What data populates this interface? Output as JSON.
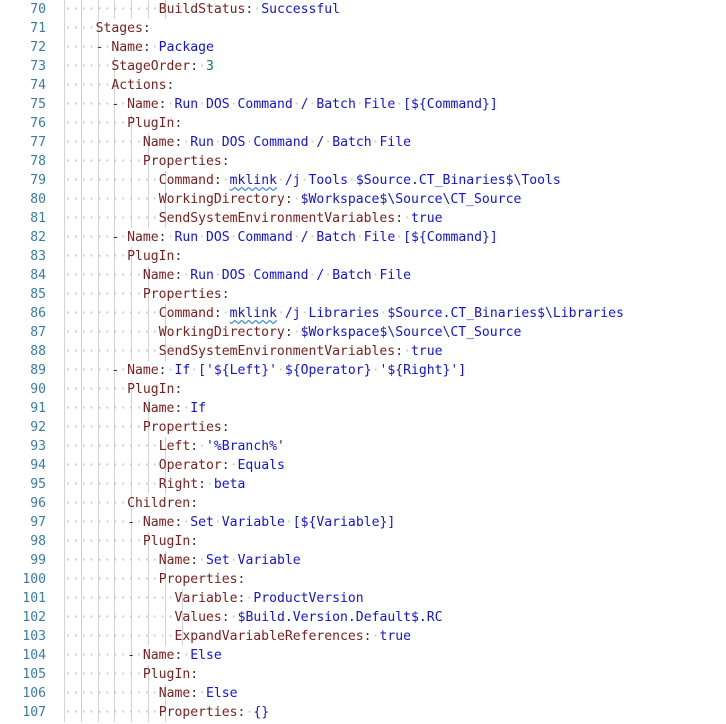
{
  "editor": {
    "language": "yaml",
    "background": "#ffffff",
    "gutter_color": "#3a7ca8",
    "key_color": "#7a2020",
    "value_color": "#1414d2",
    "number_color": "#0f7a55",
    "whitespace_dot_color": "#c9c9c9",
    "indent_guide_color": "#d3d3d3",
    "first_line_number": 70,
    "last_line_number": 107,
    "char_width": 8.4,
    "line_height": 19
  },
  "lines": [
    {
      "num": "70",
      "indent": 12,
      "tokens": [
        {
          "t": "key",
          "s": "BuildStatus"
        },
        {
          "t": "colon",
          "s": ":"
        },
        {
          "t": "sp",
          "s": " "
        },
        {
          "t": "val",
          "s": "Successful"
        }
      ]
    },
    {
      "num": "71",
      "indent": 4,
      "tokens": [
        {
          "t": "key",
          "s": "Stages"
        },
        {
          "t": "colon",
          "s": ":"
        }
      ]
    },
    {
      "num": "72",
      "indent": 4,
      "tokens": [
        {
          "t": "dash",
          "s": "-"
        },
        {
          "t": "sp",
          "s": " "
        },
        {
          "t": "key",
          "s": "Name"
        },
        {
          "t": "colon",
          "s": ":"
        },
        {
          "t": "sp",
          "s": " "
        },
        {
          "t": "val",
          "s": "Package"
        }
      ]
    },
    {
      "num": "73",
      "indent": 6,
      "tokens": [
        {
          "t": "key",
          "s": "StageOrder"
        },
        {
          "t": "colon",
          "s": ":"
        },
        {
          "t": "sp",
          "s": " "
        },
        {
          "t": "num",
          "s": "3"
        }
      ]
    },
    {
      "num": "74",
      "indent": 6,
      "tokens": [
        {
          "t": "key",
          "s": "Actions"
        },
        {
          "t": "colon",
          "s": ":"
        }
      ]
    },
    {
      "num": "75",
      "indent": 6,
      "tokens": [
        {
          "t": "dash",
          "s": "-"
        },
        {
          "t": "sp",
          "s": " "
        },
        {
          "t": "key",
          "s": "Name"
        },
        {
          "t": "colon",
          "s": ":"
        },
        {
          "t": "sp",
          "s": " "
        },
        {
          "t": "val",
          "s": "Run"
        },
        {
          "t": "sp",
          "s": " "
        },
        {
          "t": "val",
          "s": "DOS"
        },
        {
          "t": "sp",
          "s": " "
        },
        {
          "t": "val",
          "s": "Command"
        },
        {
          "t": "sp",
          "s": " "
        },
        {
          "t": "val",
          "s": "/"
        },
        {
          "t": "sp",
          "s": " "
        },
        {
          "t": "val",
          "s": "Batch"
        },
        {
          "t": "sp",
          "s": " "
        },
        {
          "t": "val",
          "s": "File"
        },
        {
          "t": "sp",
          "s": " "
        },
        {
          "t": "val",
          "s": "[${Command}]"
        }
      ]
    },
    {
      "num": "76",
      "indent": 8,
      "tokens": [
        {
          "t": "key",
          "s": "PlugIn"
        },
        {
          "t": "colon",
          "s": ":"
        }
      ]
    },
    {
      "num": "77",
      "indent": 10,
      "tokens": [
        {
          "t": "key",
          "s": "Name"
        },
        {
          "t": "colon",
          "s": ":"
        },
        {
          "t": "sp",
          "s": " "
        },
        {
          "t": "val",
          "s": "Run"
        },
        {
          "t": "sp",
          "s": " "
        },
        {
          "t": "val",
          "s": "DOS"
        },
        {
          "t": "sp",
          "s": " "
        },
        {
          "t": "val",
          "s": "Command"
        },
        {
          "t": "sp",
          "s": " "
        },
        {
          "t": "val",
          "s": "/"
        },
        {
          "t": "sp",
          "s": " "
        },
        {
          "t": "val",
          "s": "Batch"
        },
        {
          "t": "sp",
          "s": " "
        },
        {
          "t": "val",
          "s": "File"
        }
      ]
    },
    {
      "num": "78",
      "indent": 10,
      "tokens": [
        {
          "t": "key",
          "s": "Properties"
        },
        {
          "t": "colon",
          "s": ":"
        }
      ]
    },
    {
      "num": "79",
      "indent": 12,
      "tokens": [
        {
          "t": "key",
          "s": "Command"
        },
        {
          "t": "colon",
          "s": ":"
        },
        {
          "t": "sp",
          "s": " "
        },
        {
          "t": "spell",
          "s": "mklink"
        },
        {
          "t": "sp",
          "s": " "
        },
        {
          "t": "val",
          "s": "/j"
        },
        {
          "t": "sp",
          "s": " "
        },
        {
          "t": "val",
          "s": "Tools"
        },
        {
          "t": "sp",
          "s": " "
        },
        {
          "t": "val",
          "s": "$Source.CT_Binaries$\\Tools"
        }
      ]
    },
    {
      "num": "80",
      "indent": 12,
      "tokens": [
        {
          "t": "key",
          "s": "WorkingDirectory"
        },
        {
          "t": "colon",
          "s": ":"
        },
        {
          "t": "sp",
          "s": " "
        },
        {
          "t": "val",
          "s": "$Workspace$\\Source\\CT_Source"
        }
      ]
    },
    {
      "num": "81",
      "indent": 12,
      "tokens": [
        {
          "t": "key",
          "s": "SendSystemEnvironmentVariables"
        },
        {
          "t": "colon",
          "s": ":"
        },
        {
          "t": "sp",
          "s": " "
        },
        {
          "t": "val",
          "s": "true"
        }
      ]
    },
    {
      "num": "82",
      "indent": 6,
      "tokens": [
        {
          "t": "dash",
          "s": "-"
        },
        {
          "t": "sp",
          "s": " "
        },
        {
          "t": "key",
          "s": "Name"
        },
        {
          "t": "colon",
          "s": ":"
        },
        {
          "t": "sp",
          "s": " "
        },
        {
          "t": "val",
          "s": "Run"
        },
        {
          "t": "sp",
          "s": " "
        },
        {
          "t": "val",
          "s": "DOS"
        },
        {
          "t": "sp",
          "s": " "
        },
        {
          "t": "val",
          "s": "Command"
        },
        {
          "t": "sp",
          "s": " "
        },
        {
          "t": "val",
          "s": "/"
        },
        {
          "t": "sp",
          "s": " "
        },
        {
          "t": "val",
          "s": "Batch"
        },
        {
          "t": "sp",
          "s": " "
        },
        {
          "t": "val",
          "s": "File"
        },
        {
          "t": "sp",
          "s": " "
        },
        {
          "t": "val",
          "s": "[${Command}]"
        }
      ]
    },
    {
      "num": "83",
      "indent": 8,
      "tokens": [
        {
          "t": "key",
          "s": "PlugIn"
        },
        {
          "t": "colon",
          "s": ":"
        }
      ]
    },
    {
      "num": "84",
      "indent": 10,
      "tokens": [
        {
          "t": "key",
          "s": "Name"
        },
        {
          "t": "colon",
          "s": ":"
        },
        {
          "t": "sp",
          "s": " "
        },
        {
          "t": "val",
          "s": "Run"
        },
        {
          "t": "sp",
          "s": " "
        },
        {
          "t": "val",
          "s": "DOS"
        },
        {
          "t": "sp",
          "s": " "
        },
        {
          "t": "val",
          "s": "Command"
        },
        {
          "t": "sp",
          "s": " "
        },
        {
          "t": "val",
          "s": "/"
        },
        {
          "t": "sp",
          "s": " "
        },
        {
          "t": "val",
          "s": "Batch"
        },
        {
          "t": "sp",
          "s": " "
        },
        {
          "t": "val",
          "s": "File"
        }
      ]
    },
    {
      "num": "85",
      "indent": 10,
      "tokens": [
        {
          "t": "key",
          "s": "Properties"
        },
        {
          "t": "colon",
          "s": ":"
        }
      ]
    },
    {
      "num": "86",
      "indent": 12,
      "tokens": [
        {
          "t": "key",
          "s": "Command"
        },
        {
          "t": "colon",
          "s": ":"
        },
        {
          "t": "sp",
          "s": " "
        },
        {
          "t": "spell",
          "s": "mklink"
        },
        {
          "t": "sp",
          "s": " "
        },
        {
          "t": "val",
          "s": "/j"
        },
        {
          "t": "sp",
          "s": " "
        },
        {
          "t": "val",
          "s": "Libraries"
        },
        {
          "t": "sp",
          "s": " "
        },
        {
          "t": "val",
          "s": "$Source.CT_Binaries$\\Libraries"
        }
      ]
    },
    {
      "num": "87",
      "indent": 12,
      "tokens": [
        {
          "t": "key",
          "s": "WorkingDirectory"
        },
        {
          "t": "colon",
          "s": ":"
        },
        {
          "t": "sp",
          "s": " "
        },
        {
          "t": "val",
          "s": "$Workspace$\\Source\\CT_Source"
        }
      ]
    },
    {
      "num": "88",
      "indent": 12,
      "tokens": [
        {
          "t": "key",
          "s": "SendSystemEnvironmentVariables"
        },
        {
          "t": "colon",
          "s": ":"
        },
        {
          "t": "sp",
          "s": " "
        },
        {
          "t": "val",
          "s": "true"
        }
      ]
    },
    {
      "num": "89",
      "indent": 6,
      "tokens": [
        {
          "t": "dash",
          "s": "-"
        },
        {
          "t": "sp",
          "s": " "
        },
        {
          "t": "key",
          "s": "Name"
        },
        {
          "t": "colon",
          "s": ":"
        },
        {
          "t": "sp",
          "s": " "
        },
        {
          "t": "val",
          "s": "If"
        },
        {
          "t": "sp",
          "s": " "
        },
        {
          "t": "val",
          "s": "['${Left}'"
        },
        {
          "t": "sp",
          "s": " "
        },
        {
          "t": "val",
          "s": "${Operator}"
        },
        {
          "t": "sp",
          "s": " "
        },
        {
          "t": "val",
          "s": "'${Right}']"
        }
      ]
    },
    {
      "num": "90",
      "indent": 8,
      "tokens": [
        {
          "t": "key",
          "s": "PlugIn"
        },
        {
          "t": "colon",
          "s": ":"
        }
      ]
    },
    {
      "num": "91",
      "indent": 10,
      "tokens": [
        {
          "t": "key",
          "s": "Name"
        },
        {
          "t": "colon",
          "s": ":"
        },
        {
          "t": "sp",
          "s": " "
        },
        {
          "t": "val",
          "s": "If"
        }
      ]
    },
    {
      "num": "92",
      "indent": 10,
      "tokens": [
        {
          "t": "key",
          "s": "Properties"
        },
        {
          "t": "colon",
          "s": ":"
        }
      ]
    },
    {
      "num": "93",
      "indent": 12,
      "tokens": [
        {
          "t": "key",
          "s": "Left"
        },
        {
          "t": "colon",
          "s": ":"
        },
        {
          "t": "sp",
          "s": " "
        },
        {
          "t": "val",
          "s": "'%Branch%'"
        }
      ]
    },
    {
      "num": "94",
      "indent": 12,
      "tokens": [
        {
          "t": "key",
          "s": "Operator"
        },
        {
          "t": "colon",
          "s": ":"
        },
        {
          "t": "sp",
          "s": " "
        },
        {
          "t": "val",
          "s": "Equals"
        }
      ]
    },
    {
      "num": "95",
      "indent": 12,
      "tokens": [
        {
          "t": "key",
          "s": "Right"
        },
        {
          "t": "colon",
          "s": ":"
        },
        {
          "t": "sp",
          "s": " "
        },
        {
          "t": "val",
          "s": "beta"
        }
      ]
    },
    {
      "num": "96",
      "indent": 8,
      "tokens": [
        {
          "t": "key",
          "s": "Children"
        },
        {
          "t": "colon",
          "s": ":"
        }
      ]
    },
    {
      "num": "97",
      "indent": 8,
      "tokens": [
        {
          "t": "dash",
          "s": "-"
        },
        {
          "t": "sp",
          "s": " "
        },
        {
          "t": "key",
          "s": "Name"
        },
        {
          "t": "colon",
          "s": ":"
        },
        {
          "t": "sp",
          "s": " "
        },
        {
          "t": "val",
          "s": "Set"
        },
        {
          "t": "sp",
          "s": " "
        },
        {
          "t": "val",
          "s": "Variable"
        },
        {
          "t": "sp",
          "s": " "
        },
        {
          "t": "val",
          "s": "[${Variable}]"
        }
      ]
    },
    {
      "num": "98",
      "indent": 10,
      "tokens": [
        {
          "t": "key",
          "s": "PlugIn"
        },
        {
          "t": "colon",
          "s": ":"
        }
      ]
    },
    {
      "num": "99",
      "indent": 12,
      "tokens": [
        {
          "t": "key",
          "s": "Name"
        },
        {
          "t": "colon",
          "s": ":"
        },
        {
          "t": "sp",
          "s": " "
        },
        {
          "t": "val",
          "s": "Set"
        },
        {
          "t": "sp",
          "s": " "
        },
        {
          "t": "val",
          "s": "Variable"
        }
      ]
    },
    {
      "num": "100",
      "indent": 12,
      "tokens": [
        {
          "t": "key",
          "s": "Properties"
        },
        {
          "t": "colon",
          "s": ":"
        }
      ]
    },
    {
      "num": "101",
      "indent": 14,
      "tokens": [
        {
          "t": "key",
          "s": "Variable"
        },
        {
          "t": "colon",
          "s": ":"
        },
        {
          "t": "sp",
          "s": " "
        },
        {
          "t": "val",
          "s": "ProductVersion"
        }
      ]
    },
    {
      "num": "102",
      "indent": 14,
      "tokens": [
        {
          "t": "key",
          "s": "Values"
        },
        {
          "t": "colon",
          "s": ":"
        },
        {
          "t": "sp",
          "s": " "
        },
        {
          "t": "val",
          "s": "$Build.Version.Default$.RC"
        }
      ]
    },
    {
      "num": "103",
      "indent": 14,
      "tokens": [
        {
          "t": "key",
          "s": "ExpandVariableReferences"
        },
        {
          "t": "colon",
          "s": ":"
        },
        {
          "t": "sp",
          "s": " "
        },
        {
          "t": "val",
          "s": "true"
        }
      ]
    },
    {
      "num": "104",
      "indent": 8,
      "tokens": [
        {
          "t": "dash",
          "s": "-"
        },
        {
          "t": "sp",
          "s": " "
        },
        {
          "t": "key",
          "s": "Name"
        },
        {
          "t": "colon",
          "s": ":"
        },
        {
          "t": "sp",
          "s": " "
        },
        {
          "t": "val",
          "s": "Else"
        }
      ]
    },
    {
      "num": "105",
      "indent": 10,
      "tokens": [
        {
          "t": "key",
          "s": "PlugIn"
        },
        {
          "t": "colon",
          "s": ":"
        }
      ]
    },
    {
      "num": "106",
      "indent": 12,
      "tokens": [
        {
          "t": "key",
          "s": "Name"
        },
        {
          "t": "colon",
          "s": ":"
        },
        {
          "t": "sp",
          "s": " "
        },
        {
          "t": "val",
          "s": "Else"
        }
      ]
    },
    {
      "num": "107",
      "indent": 12,
      "tokens": [
        {
          "t": "key",
          "s": "Properties"
        },
        {
          "t": "colon",
          "s": ":"
        },
        {
          "t": "sp",
          "s": " "
        },
        {
          "t": "brace",
          "s": "{}"
        }
      ]
    }
  ]
}
